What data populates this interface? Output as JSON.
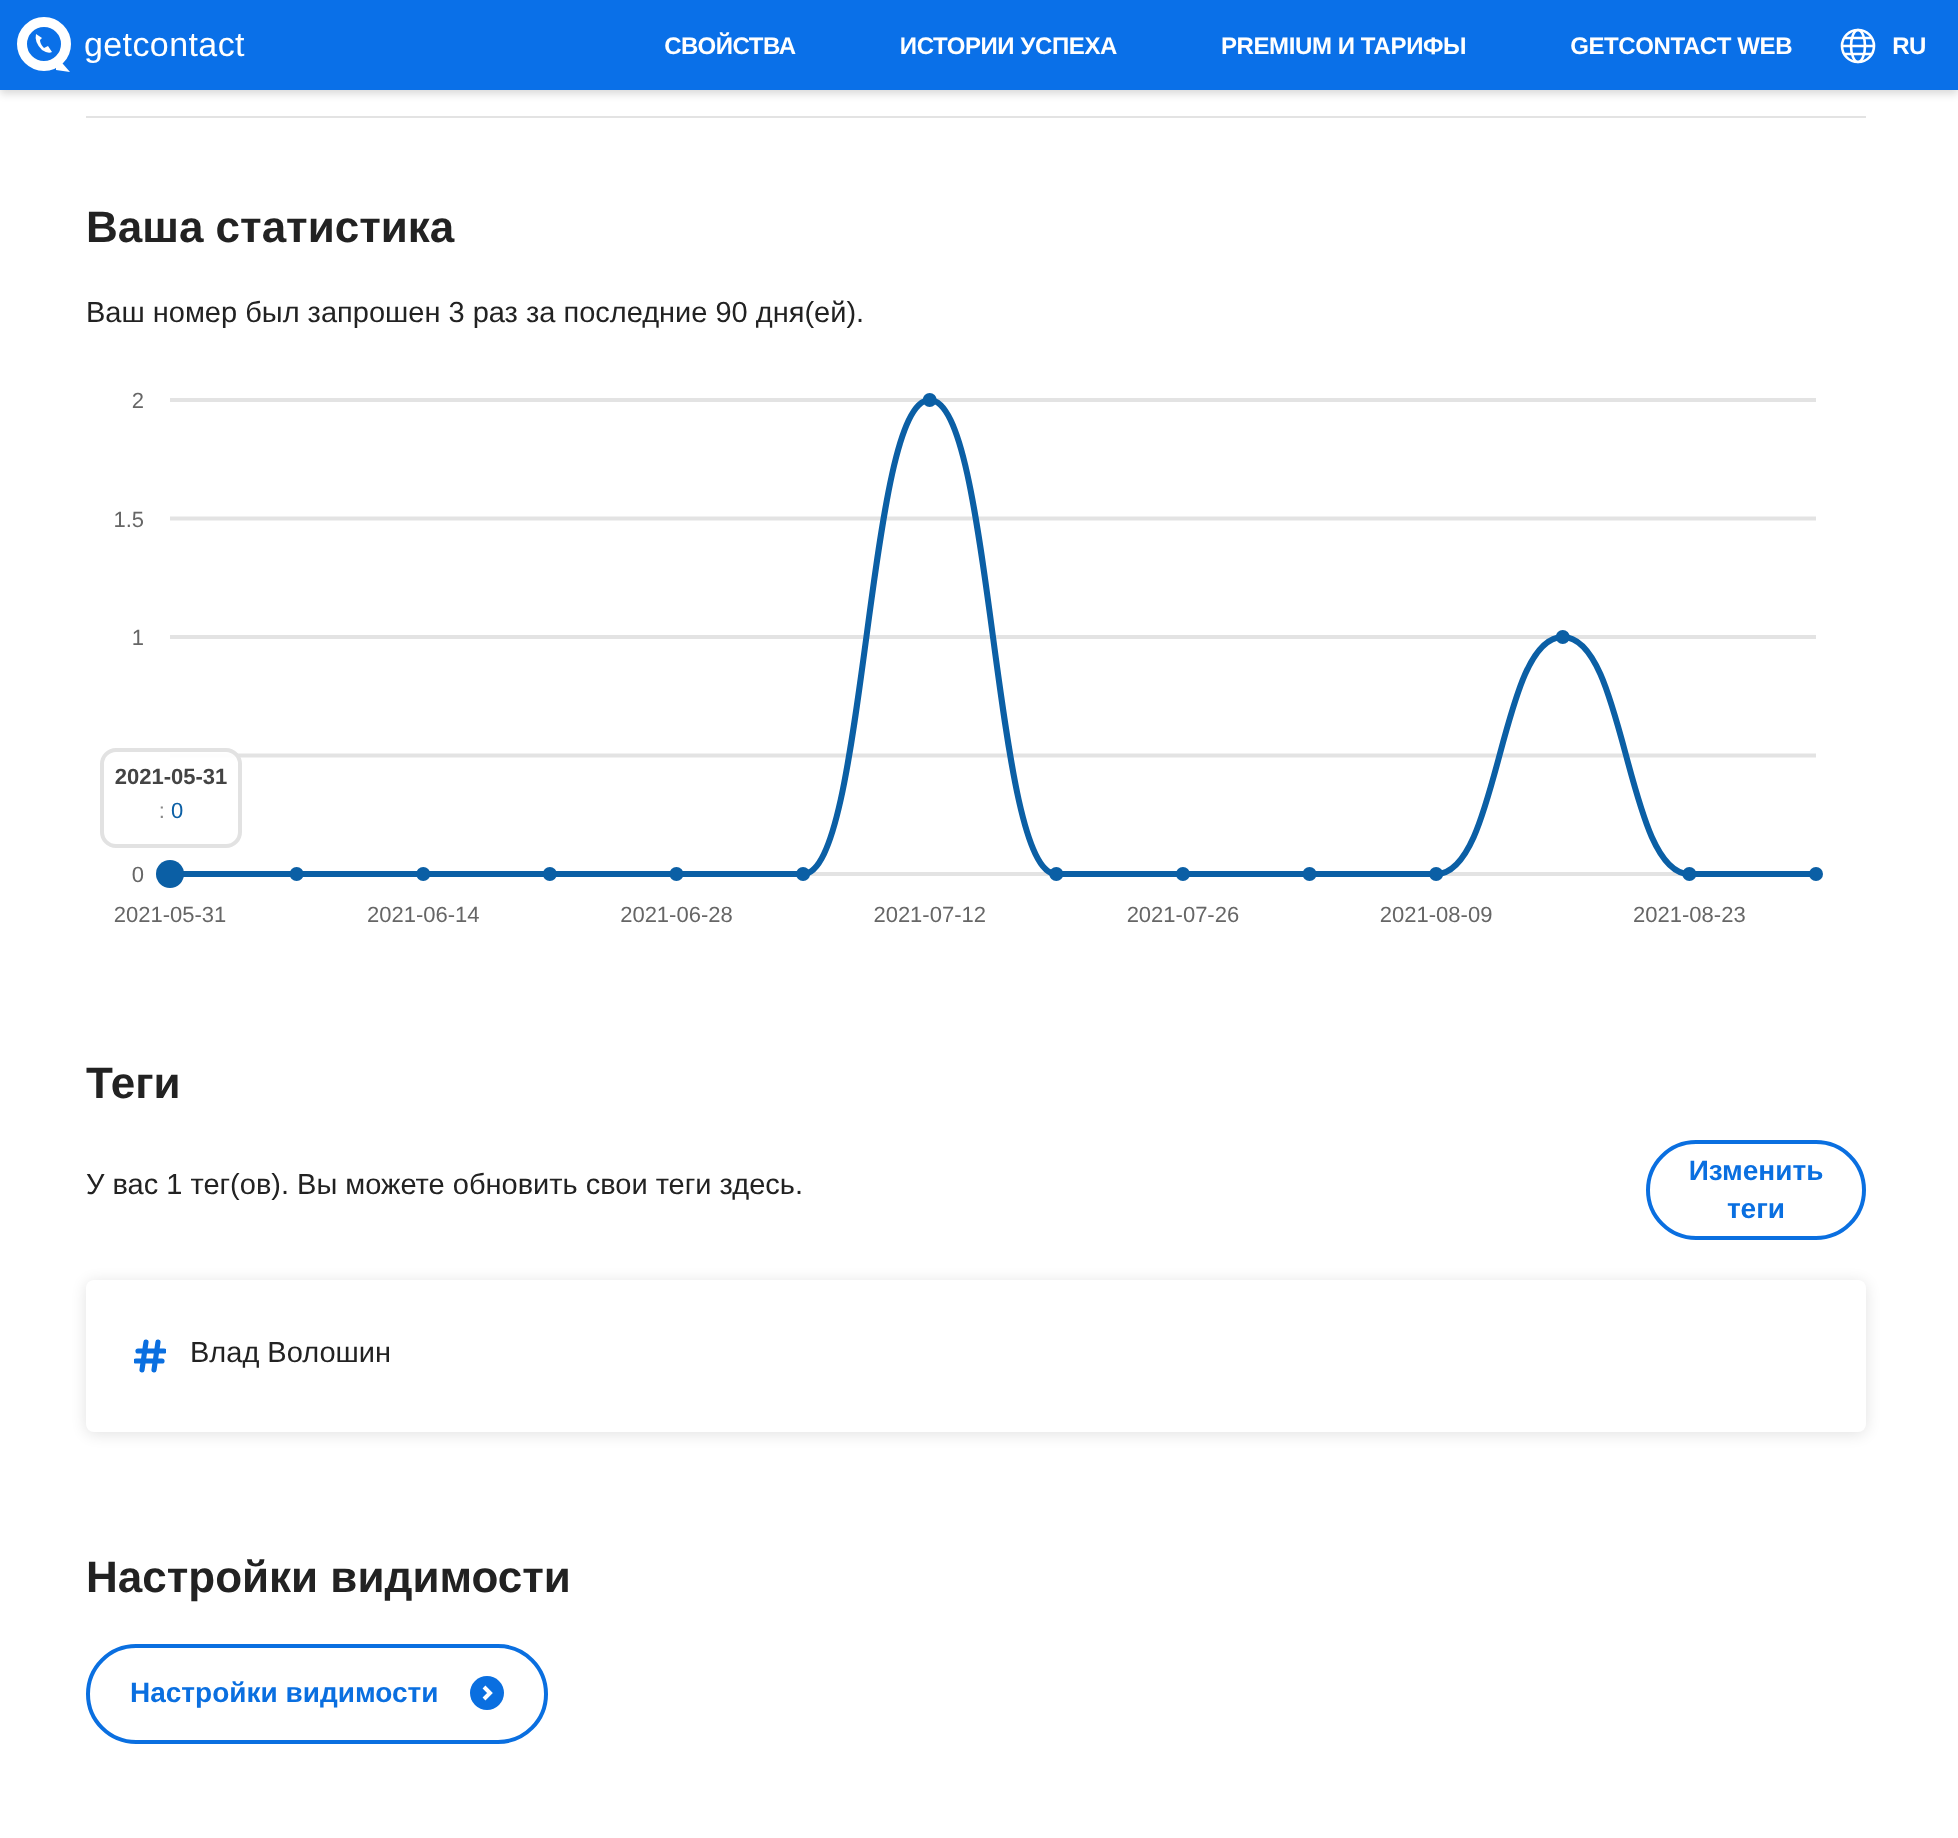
{
  "navbar": {
    "brand": "getcontact",
    "links": [
      {
        "label": "СВОЙСТВА"
      },
      {
        "label": "ИСТОРИИ УСПЕХА"
      },
      {
        "label": "PREMIUM И ТАРИФЫ"
      },
      {
        "label": "GETCONTACT WEB"
      }
    ],
    "language": "RU"
  },
  "statistics": {
    "title": "Ваша статистика",
    "summary": "Ваш номер был запрошен 3 раз за последние 90 дня(ей).",
    "chart_data": {
      "type": "line",
      "categories": [
        "2021-05-31",
        null,
        "2021-06-14",
        null,
        "2021-06-28",
        null,
        "2021-07-12",
        null,
        "2021-07-26",
        null,
        "2021-08-09",
        null,
        "2021-08-23",
        null
      ],
      "series": [
        {
          "color": "#0b5fa5",
          "marker": true,
          "values": [
            0,
            0,
            0,
            0,
            0,
            0,
            2,
            0,
            0,
            0,
            0,
            1,
            0,
            0
          ]
        }
      ],
      "ylim": [
        0,
        2
      ],
      "yticks": [
        0,
        1,
        1.5,
        2
      ]
    },
    "tooltip": {
      "title": "2021-05-31",
      "separator": ": ",
      "value": "0"
    }
  },
  "tags": {
    "title": "Теги",
    "summary": "У вас 1 тег(ов). Вы можете обновить свои теги здесь.",
    "edit_button": "Изменить теги",
    "items": [
      {
        "label": "Влад Волошин"
      }
    ]
  },
  "visibility": {
    "title": "Настройки видимости",
    "button": "Настройки видимости"
  }
}
